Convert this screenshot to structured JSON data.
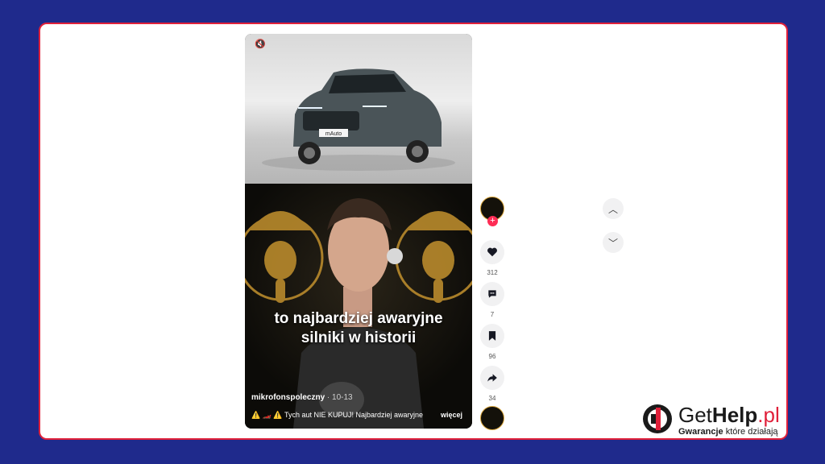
{
  "video": {
    "caption": "to najbardziej awaryjne silniki w historii",
    "username": "mikrofonspoleczny",
    "date": "· 10-13",
    "description": "⚠️ 🏎️ ⚠️ Tych aut NIE KUPUJ! Najbardziej awaryjne",
    "more_label": "więcej",
    "car_badge": "mAuto"
  },
  "actions": {
    "likes": "312",
    "comments": "7",
    "saves": "96",
    "shares": "34"
  },
  "brand": {
    "name_prefix": "Get",
    "name_bold": "Help",
    "name_suffix": ".pl",
    "tagline_bold": "Gwarancje",
    "tagline_rest": " które działają",
    "accent": "#e0203a",
    "background": "#1f2a8c"
  }
}
